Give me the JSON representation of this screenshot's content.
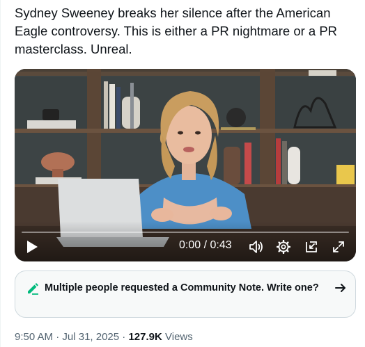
{
  "post": {
    "text": "Sydney Sweeney breaks her silence after the American Eagle controversy. This is either a PR nightmare or a PR masterclass. Unreal."
  },
  "video": {
    "current_time": "0:00",
    "separator": " / ",
    "duration": "0:43",
    "progress": 0,
    "icons": {
      "play": "play-icon",
      "volume": "volume-icon",
      "settings": "gear-icon",
      "dock": "picture-in-picture-icon",
      "fullscreen": "fullscreen-icon"
    }
  },
  "community_note": {
    "text": "Multiple people requested a Community Note. Write one?",
    "icon": "pencil-icon",
    "accent": "#00ba7c",
    "arrow": "arrow-right-icon"
  },
  "meta": {
    "time": "9:50 AM",
    "dot1": " · ",
    "date": "Jul 31, 2025",
    "dot2": " · ",
    "views_count": "127.9K",
    "views_label": " Views"
  }
}
